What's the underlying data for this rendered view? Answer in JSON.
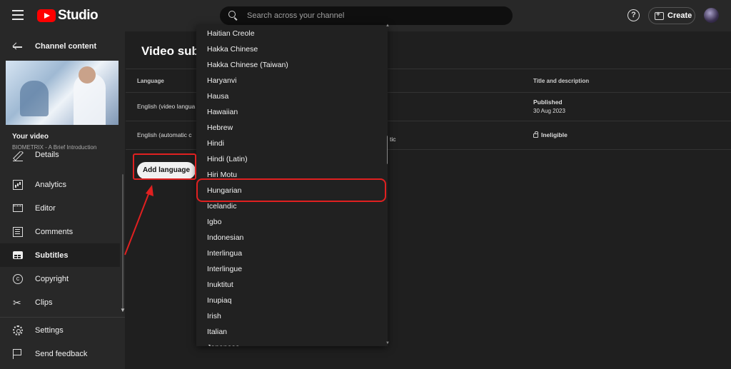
{
  "app": {
    "brand": "Studio",
    "brand_color": "#ff0000"
  },
  "header": {
    "search_placeholder": "Search across your channel",
    "create_label": "Create"
  },
  "sidebar": {
    "back_label": "Channel content",
    "your_video_label": "Your video",
    "video_title": "BIOMETRIX - A Brief Introduction",
    "items": [
      {
        "label": "Details",
        "icon": "pencil-icon"
      },
      {
        "label": "Analytics",
        "icon": "analytics-icon"
      },
      {
        "label": "Editor",
        "icon": "editor-icon"
      },
      {
        "label": "Comments",
        "icon": "comments-icon"
      },
      {
        "label": "Subtitles",
        "icon": "subtitles-icon",
        "active": true
      },
      {
        "label": "Copyright",
        "icon": "copyright-icon"
      },
      {
        "label": "Clips",
        "icon": "clips-icon"
      }
    ],
    "footer_items": [
      {
        "label": "Settings",
        "icon": "gear-icon"
      },
      {
        "label": "Send feedback",
        "icon": "feedback-icon"
      }
    ]
  },
  "main": {
    "title": "Video subt",
    "columns": {
      "language": "Language",
      "title_desc": "Title and description"
    },
    "rows": [
      {
        "language": "English (video langua",
        "mid": "",
        "status": "Published",
        "date": "30 Aug 2023"
      },
      {
        "language": "English (automatic c",
        "mid": "tic",
        "status": "Ineligible",
        "date": ""
      }
    ],
    "add_language_label": "Add language"
  },
  "dropdown": {
    "items": [
      "Haitian Creole",
      "Hakka Chinese",
      "Hakka Chinese (Taiwan)",
      "Haryanvi",
      "Hausa",
      "Hawaiian",
      "Hebrew",
      "Hindi",
      "Hindi (Latin)",
      "Hiri Motu",
      "Hungarian",
      "Icelandic",
      "Igbo",
      "Indonesian",
      "Interlingua",
      "Interlingue",
      "Inuktitut",
      "Inupiaq",
      "Irish",
      "Italian",
      "Japanese"
    ],
    "highlighted": "Hungarian"
  },
  "annotation_color": "#e02020"
}
